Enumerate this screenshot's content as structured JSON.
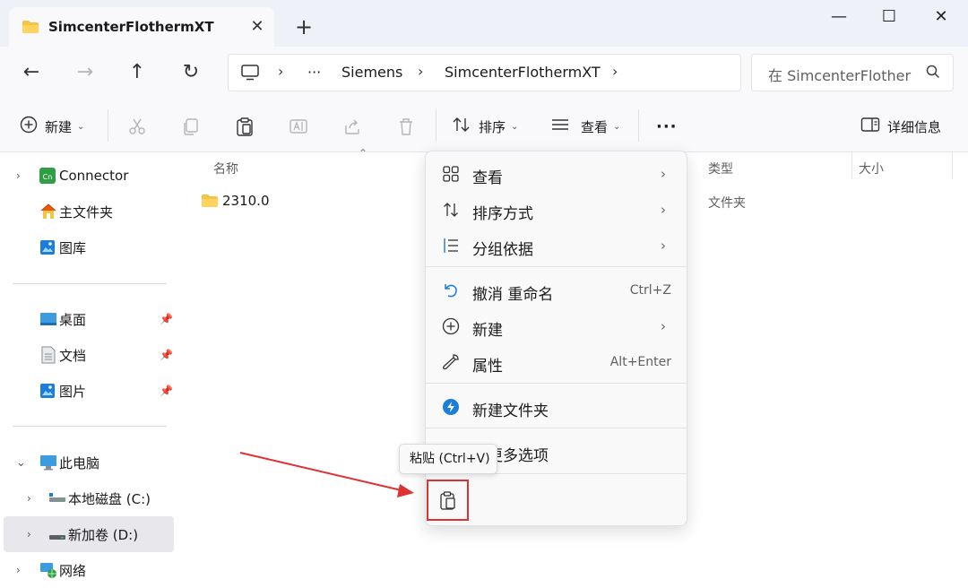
{
  "window": {
    "tab_title": "SimcenterFlothermXT",
    "tab_close": "✕",
    "new_tab": "+",
    "controls": {
      "minimize": "—",
      "maximize": "☐",
      "close": "✕"
    }
  },
  "address": {
    "overflow": "···",
    "crumbs": [
      "Siemens",
      "SimcenterFlothermXT"
    ],
    "separator": "›",
    "search_placeholder": "在 SimcenterFlother"
  },
  "toolbar": {
    "new_label": "新建",
    "sort_label": "排序",
    "view_label": "查看",
    "more_label": "···",
    "details_label": "详细信息"
  },
  "sidebar": {
    "items": [
      {
        "label": "Connector",
        "icon": "connector-icon"
      },
      {
        "label": "主文件夹",
        "icon": "home-icon"
      },
      {
        "label": "图库",
        "icon": "gallery-icon"
      },
      {
        "label": "桌面",
        "icon": "desktop-icon"
      },
      {
        "label": "文档",
        "icon": "documents-icon"
      },
      {
        "label": "图片",
        "icon": "pictures-icon"
      },
      {
        "label": "此电脑",
        "icon": "pc-icon"
      },
      {
        "label": "本地磁盘 (C:)",
        "icon": "drive-icon"
      },
      {
        "label": "新加卷 (D:)",
        "icon": "drive-icon"
      },
      {
        "label": "网络",
        "icon": "network-icon"
      }
    ]
  },
  "content": {
    "columns": {
      "name": "名称",
      "type": "类型",
      "size": "大小"
    },
    "files": [
      {
        "name": "2310.0",
        "type": "文件夹"
      }
    ]
  },
  "context_menu": {
    "items": [
      {
        "label": "查看",
        "submenu": true
      },
      {
        "label": "排序方式",
        "submenu": true
      },
      {
        "label": "分组依据",
        "submenu": true
      },
      {
        "label": "撤消 重命名",
        "shortcut": "Ctrl+Z"
      },
      {
        "label": "新建",
        "submenu": true
      },
      {
        "label": "属性",
        "shortcut": "Alt+Enter"
      },
      {
        "label": "新建文件夹"
      },
      {
        "label": "示更多选项"
      }
    ],
    "submenu_arrow": "›"
  },
  "tooltip": {
    "text": "粘贴 (Ctrl+V)"
  },
  "colors": {
    "accent": "#0067c0",
    "highlight_box": "#e03131",
    "folder": "#f4c542"
  }
}
